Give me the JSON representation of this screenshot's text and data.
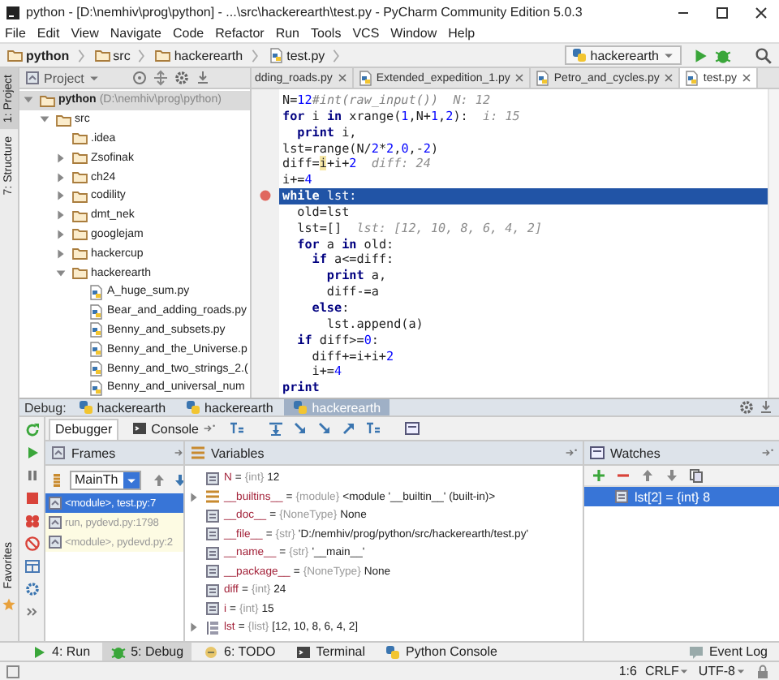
{
  "window": {
    "title": "python - [D:\\nemhiv\\prog\\python] - ...\\src\\hackerearth\\test.py - PyCharm Community Edition 5.0.3"
  },
  "menu": [
    "File",
    "Edit",
    "View",
    "Navigate",
    "Code",
    "Refactor",
    "Run",
    "Tools",
    "VCS",
    "Window",
    "Help"
  ],
  "breadcrumbs": [
    {
      "label": "python",
      "kind": "project"
    },
    {
      "label": "src",
      "kind": "folder"
    },
    {
      "label": "hackerearth",
      "kind": "folder"
    },
    {
      "label": "test.py",
      "kind": "file"
    }
  ],
  "run_config": {
    "label": "hackerearth"
  },
  "side_tabs": [
    {
      "label": "1: Project",
      "selected": true
    },
    {
      "label": "7: Structure",
      "selected": false
    }
  ],
  "side_tabs_bottom": [
    {
      "label": "Favorites",
      "selected": false
    }
  ],
  "project_panel": {
    "title": "Project",
    "tree": [
      {
        "label": "python",
        "path": "(D:\\nemhiv\\prog\\python)",
        "kind": "project",
        "expanded": true,
        "selected": true,
        "children": [
          {
            "label": "src",
            "kind": "folder",
            "expanded": true,
            "selected": false,
            "children": [
              {
                "label": ".idea",
                "kind": "folder",
                "selected": false
              },
              {
                "label": "Zsofinak",
                "kind": "folder",
                "expanded": false,
                "selected": false
              },
              {
                "label": "ch24",
                "kind": "folder",
                "expanded": false,
                "selected": false
              },
              {
                "label": "codility",
                "kind": "folder",
                "expanded": false,
                "selected": false
              },
              {
                "label": "dmt_nek",
                "kind": "folder",
                "expanded": false,
                "selected": false
              },
              {
                "label": "googlejam",
                "kind": "folder",
                "expanded": false,
                "selected": false
              },
              {
                "label": "hackercup",
                "kind": "folder",
                "expanded": false,
                "selected": false
              },
              {
                "label": "hackerearth",
                "kind": "folder",
                "expanded": true,
                "selected": false,
                "children": [
                  {
                    "label": "A_huge_sum.py",
                    "kind": "file",
                    "selected": false
                  },
                  {
                    "label": "Bear_and_adding_roads.py",
                    "kind": "file",
                    "selected": false
                  },
                  {
                    "label": "Benny_and_subsets.py",
                    "kind": "file",
                    "selected": false
                  },
                  {
                    "label": "Benny_and_the_Universe.p",
                    "kind": "file",
                    "selected": false
                  },
                  {
                    "label": "Benny_and_two_strings_2.(",
                    "kind": "file",
                    "selected": false
                  },
                  {
                    "label": "Benny_and_universal_num",
                    "kind": "file",
                    "selected": false
                  }
                ]
              }
            ]
          }
        ]
      }
    ]
  },
  "editor_tabs": [
    {
      "label": "dding_roads.py",
      "selected": false
    },
    {
      "label": "Extended_expedition_1.py",
      "selected": false
    },
    {
      "label": "Petro_and_cycles.py",
      "selected": false
    },
    {
      "label": "test.py",
      "selected": true
    }
  ],
  "code": [
    {
      "selected": false,
      "breakpoint": false,
      "tokens": [
        {
          "kind": "plain",
          "text": "N="
        },
        {
          "kind": "num",
          "text": "12"
        },
        {
          "kind": "comment",
          "text": "#int(raw_input())"
        },
        {
          "kind": "hint",
          "text": "  N: 12"
        }
      ]
    },
    {
      "selected": false,
      "breakpoint": false,
      "tokens": [
        {
          "kind": "kw",
          "text": "for"
        },
        {
          "kind": "plain",
          "text": " i "
        },
        {
          "kind": "kw",
          "text": "in"
        },
        {
          "kind": "plain",
          "text": " xrange("
        },
        {
          "kind": "num",
          "text": "1"
        },
        {
          "kind": "plain",
          "text": ",N+"
        },
        {
          "kind": "num",
          "text": "1"
        },
        {
          "kind": "plain",
          "text": ","
        },
        {
          "kind": "num",
          "text": "2"
        },
        {
          "kind": "plain",
          "text": "):"
        },
        {
          "kind": "hint",
          "text": "  i: 15"
        }
      ]
    },
    {
      "selected": false,
      "breakpoint": false,
      "tokens": [
        {
          "kind": "kw",
          "text": "  print"
        },
        {
          "kind": "plain",
          "text": " i,"
        }
      ]
    },
    {
      "selected": false,
      "breakpoint": false,
      "tokens": [
        {
          "kind": "plain",
          "text": "lst=range(N/"
        },
        {
          "kind": "num",
          "text": "2"
        },
        {
          "kind": "plain",
          "text": "*"
        },
        {
          "kind": "num",
          "text": "2"
        },
        {
          "kind": "plain",
          "text": ","
        },
        {
          "kind": "num",
          "text": "0"
        },
        {
          "kind": "plain",
          "text": ",-"
        },
        {
          "kind": "num",
          "text": "2"
        },
        {
          "kind": "plain",
          "text": ")"
        }
      ]
    },
    {
      "selected": false,
      "breakpoint": false,
      "tokens": [
        {
          "kind": "plain",
          "text": "diff="
        },
        {
          "kind": "mark",
          "text": "i"
        },
        {
          "kind": "plain",
          "text": "+i+"
        },
        {
          "kind": "num",
          "text": "2"
        },
        {
          "kind": "hint",
          "text": "  diff: 24"
        }
      ]
    },
    {
      "selected": false,
      "breakpoint": false,
      "tokens": [
        {
          "kind": "plain",
          "text": "i+="
        },
        {
          "kind": "num",
          "text": "4"
        }
      ]
    },
    {
      "selected": true,
      "breakpoint": true,
      "tokens": [
        {
          "kind": "kw",
          "text": "while"
        },
        {
          "kind": "plain",
          "text": " lst:"
        }
      ]
    },
    {
      "selected": false,
      "breakpoint": false,
      "tokens": [
        {
          "kind": "plain",
          "text": "  old=lst"
        }
      ]
    },
    {
      "selected": false,
      "breakpoint": false,
      "tokens": [
        {
          "kind": "plain",
          "text": "  lst=[]"
        },
        {
          "kind": "hint",
          "text": "  lst: [12, 10, 8, 6, 4, 2]"
        }
      ]
    },
    {
      "selected": false,
      "breakpoint": false,
      "tokens": [
        {
          "kind": "kw",
          "text": "  for"
        },
        {
          "kind": "plain",
          "text": " a "
        },
        {
          "kind": "kw",
          "text": "in"
        },
        {
          "kind": "plain",
          "text": " old:"
        }
      ]
    },
    {
      "selected": false,
      "breakpoint": false,
      "tokens": [
        {
          "kind": "kw",
          "text": "    if"
        },
        {
          "kind": "plain",
          "text": " a<=diff:"
        }
      ]
    },
    {
      "selected": false,
      "breakpoint": false,
      "tokens": [
        {
          "kind": "kw",
          "text": "      print"
        },
        {
          "kind": "plain",
          "text": " a,"
        }
      ]
    },
    {
      "selected": false,
      "breakpoint": false,
      "tokens": [
        {
          "kind": "plain",
          "text": "      diff-=a"
        }
      ]
    },
    {
      "selected": false,
      "breakpoint": false,
      "tokens": [
        {
          "kind": "kw",
          "text": "    else"
        },
        {
          "kind": "plain",
          "text": ":"
        }
      ]
    },
    {
      "selected": false,
      "breakpoint": false,
      "tokens": [
        {
          "kind": "plain",
          "text": "      lst.append(a)"
        }
      ]
    },
    {
      "selected": false,
      "breakpoint": false,
      "tokens": [
        {
          "kind": "kw",
          "text": "  if"
        },
        {
          "kind": "plain",
          "text": " diff>="
        },
        {
          "kind": "num",
          "text": "0"
        },
        {
          "kind": "plain",
          "text": ":"
        }
      ]
    },
    {
      "selected": false,
      "breakpoint": false,
      "tokens": [
        {
          "kind": "plain",
          "text": "    diff+=i+i+"
        },
        {
          "kind": "num",
          "text": "2"
        }
      ]
    },
    {
      "selected": false,
      "breakpoint": false,
      "tokens": [
        {
          "kind": "plain",
          "text": "    i+="
        },
        {
          "kind": "num",
          "text": "4"
        }
      ]
    },
    {
      "selected": false,
      "breakpoint": false,
      "tokens": [
        {
          "kind": "kw",
          "text": "print"
        }
      ]
    }
  ],
  "debug": {
    "label": "Debug:",
    "sessions": [
      {
        "label": "hackerearth",
        "selected": false
      },
      {
        "label": "hackerearth",
        "selected": false
      },
      {
        "label": "hackerearth",
        "selected": true
      }
    ],
    "tabs": [
      {
        "label": "Debugger",
        "selected": true
      },
      {
        "label": "Console",
        "selected": false
      }
    ],
    "frames": {
      "title": "Frames",
      "thread": "MainTh",
      "items": [
        {
          "label": "<module>, test.py:7",
          "kind": "user",
          "selected": true
        },
        {
          "label": "run, pydevd.py:1798",
          "kind": "library",
          "selected": false
        },
        {
          "label": "<module>, pydevd.py:2",
          "kind": "library",
          "selected": false
        }
      ]
    },
    "variables": {
      "title": "Variables",
      "items": [
        {
          "name": "N",
          "assign": "=",
          "type": "{int}",
          "value": "12",
          "kind": "field"
        },
        {
          "name": "__builtins__",
          "assign": "=",
          "type": "{module}",
          "value": "<module '__builtin__' (built-in)>",
          "kind": "module",
          "expanded": false
        },
        {
          "name": "__doc__",
          "assign": "=",
          "type": "{NoneType}",
          "value": "None",
          "kind": "field"
        },
        {
          "name": "__file__",
          "assign": "=",
          "type": "{str}",
          "value": "'D:/nemhiv/prog/python/src/hackerearth/test.py'",
          "kind": "field"
        },
        {
          "name": "__name__",
          "assign": "=",
          "type": "{str}",
          "value": "'__main__'",
          "kind": "field"
        },
        {
          "name": "__package__",
          "assign": "=",
          "type": "{NoneType}",
          "value": "None",
          "kind": "field"
        },
        {
          "name": "diff",
          "assign": "=",
          "type": "{int}",
          "value": "24",
          "kind": "field"
        },
        {
          "name": "i",
          "assign": "=",
          "type": "{int}",
          "value": "15",
          "kind": "field"
        },
        {
          "name": "lst",
          "assign": "=",
          "type": "{list}",
          "value": "[12, 10, 8, 6, 4, 2]",
          "kind": "list",
          "expanded": false
        }
      ]
    },
    "watches": {
      "title": "Watches",
      "items": [
        {
          "name": "lst[2]",
          "assign": "=",
          "type": "{int}",
          "value": "8",
          "selected": true
        }
      ]
    }
  },
  "tool_windows": [
    {
      "label": "4: Run",
      "kind": "run",
      "selected": false
    },
    {
      "label": "5: Debug",
      "kind": "debug",
      "selected": true
    },
    {
      "label": "6: TODO",
      "kind": "todo",
      "selected": false
    },
    {
      "label": "Terminal",
      "kind": "terminal",
      "selected": false
    },
    {
      "label": "Python Console",
      "kind": "python",
      "selected": false
    }
  ],
  "event_log": {
    "label": "Event Log"
  },
  "status_bar": {
    "position": "1:6",
    "line_separator": "CRLF",
    "encoding": "UTF-8"
  }
}
